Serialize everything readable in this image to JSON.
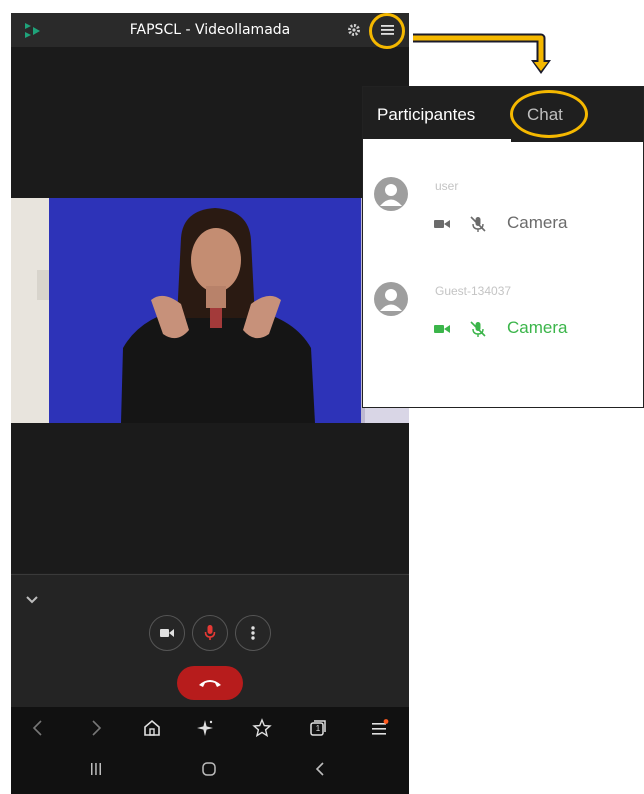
{
  "app": {
    "title": "FAPSCL - Videollamada"
  },
  "panel": {
    "tabs": [
      {
        "label": "Participantes",
        "active": true
      },
      {
        "label": "Chat",
        "active": false
      }
    ],
    "participants": [
      {
        "name": "user",
        "status_label": "Camera",
        "video_on": false,
        "mic_muted": true,
        "status_color": "#6b6b6b"
      },
      {
        "name": "Guest-134037",
        "status_label": "Camera",
        "video_on": true,
        "mic_muted": true,
        "status_color": "#3bb54a"
      }
    ]
  },
  "colors": {
    "highlight": "#f5b800",
    "accent_green": "#3bb54a",
    "hangup": "#b71c1c",
    "video_bg": "#2d33b8",
    "mic_red": "#e53935"
  },
  "icons": [
    "app-logo-icon",
    "settings-icon",
    "menu-icon",
    "collapse-chevron-icon",
    "video-camera-icon",
    "microphone-icon",
    "more-options-icon",
    "hang-up-icon",
    "back-icon",
    "forward-icon",
    "home-icon",
    "ai-sparkle-icon",
    "favorites-icon",
    "tabs-icon",
    "browser-menu-icon",
    "recent-apps-icon",
    "home-circle-icon",
    "nav-back-icon",
    "avatar-icon",
    "mic-off-icon",
    "arrow-icon"
  ],
  "browser": {
    "tab_count": "1"
  }
}
